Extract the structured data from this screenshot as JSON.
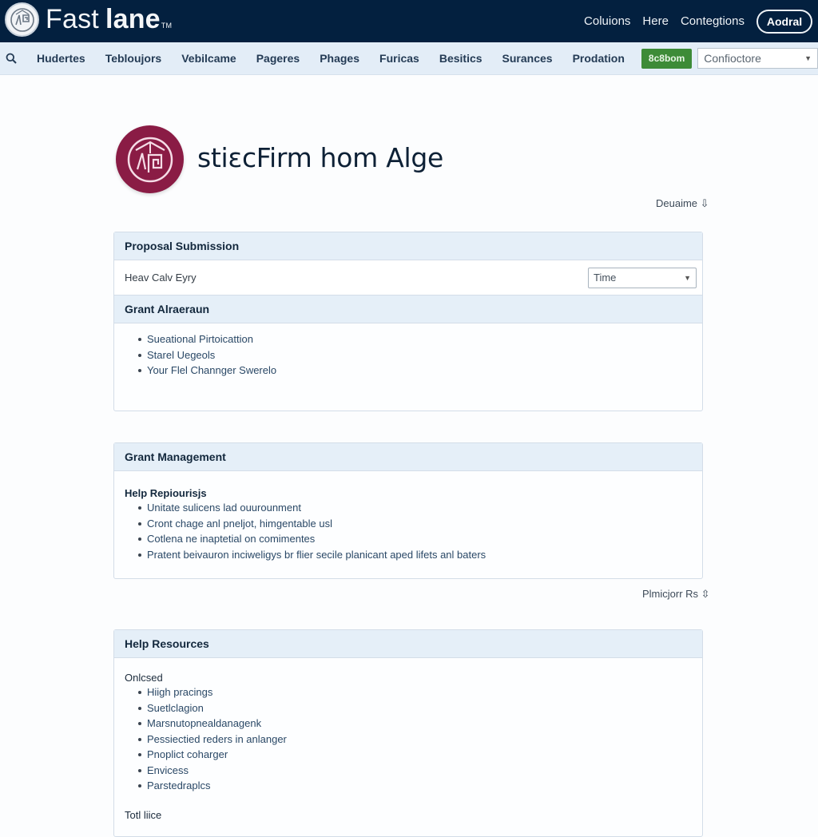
{
  "header": {
    "brand_light": "Fast",
    "brand_bold": "lane",
    "brand_tm": "TM",
    "links": [
      "Coluions",
      "Here",
      "Contegtions"
    ],
    "action_button": "Aodral"
  },
  "navbar": {
    "search_icon": "search-icon",
    "items": [
      "Hudertes",
      "Tebloujors",
      "Vebilcame",
      "Pageres",
      "Phages",
      "Furicas",
      "Besitics",
      "Surances",
      "Prodation"
    ],
    "green_button": "8c8bom",
    "select_value": "Confioctore"
  },
  "page": {
    "title": "stiεcFirm hom Alge",
    "top_meta_link": "Deuaime ⇩",
    "mid_meta_link": "Plmicjorr Rs ⇳"
  },
  "proposal_panel": {
    "title": "Proposal Submission",
    "row_label": "Heav Calv Eyry",
    "row_select_value": "Time",
    "section_title": "Grant Alraeraun",
    "items": [
      "Sueational Pirtoicattion",
      "Starel Uegeols",
      "Your Flel Channger Swerelo"
    ]
  },
  "management_panel": {
    "title": "Grant Management",
    "sub_heading": "Help Repiourisjs",
    "items": [
      "Unitate sulicens lad ouurounment",
      "Cront chage anl pneljot, himgentable usl",
      "Cotlena ne inaptetial on comimentes",
      "Pratent beivauron inciweligys br flier secile planicant aped lifets anl baters"
    ]
  },
  "resources_panel": {
    "title": "Help Resources",
    "sub_heading": "Onlcsed",
    "items": [
      "Hiigh pracings",
      "Suetlclagion",
      "Marsnutopnealdanagenk",
      "Pessiectied reders in anlanger",
      "Pnoplict coharger",
      "Envicess",
      "Parstedraplcs"
    ],
    "footer_heading": "Totl liice"
  },
  "colors": {
    "header_bg": "#03203f",
    "nav_bg": "#e3edf7",
    "green_button": "#3d8b37",
    "org_logo": "#8a1c45",
    "panel_head_bg": "#e5eff8",
    "link_text": "#2a4866"
  }
}
